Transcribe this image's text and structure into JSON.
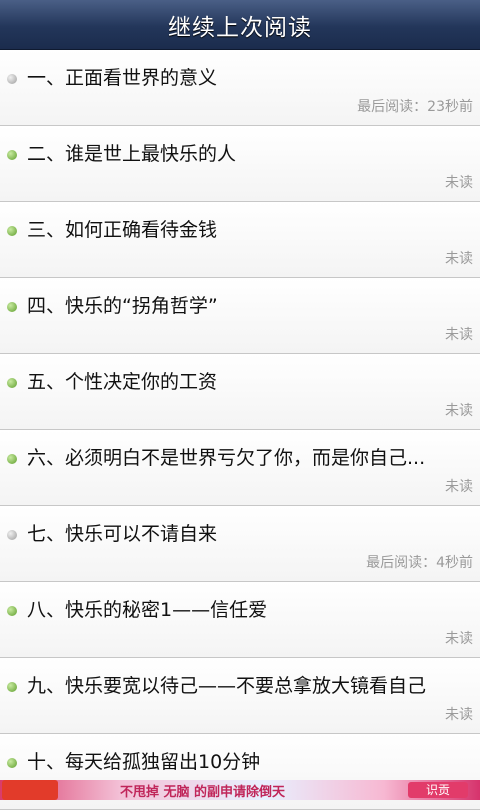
{
  "header": {
    "title": "继续上次阅读"
  },
  "items": [
    {
      "title": "一、正面看世界的意义",
      "status": "最后阅读：23秒前",
      "read": true
    },
    {
      "title": "二、谁是世上最快乐的人",
      "status": "未读",
      "read": false
    },
    {
      "title": "三、如何正确看待金钱",
      "status": "未读",
      "read": false
    },
    {
      "title": "四、快乐的“拐角哲学”",
      "status": "未读",
      "read": false
    },
    {
      "title": "五、个性决定你的工资",
      "status": "未读",
      "read": false
    },
    {
      "title": "六、必须明白不是世界亏欠了你，而是你自己...",
      "status": "未读",
      "read": false
    },
    {
      "title": "七、快乐可以不请自来",
      "status": "最后阅读：4秒前",
      "read": true
    },
    {
      "title": "八、快乐的秘密1——信任爱",
      "status": "未读",
      "read": false
    },
    {
      "title": "九、快乐要宽以待己——不要总拿放大镜看自己",
      "status": "未读",
      "read": false
    },
    {
      "title": "十、每天给孤独留出10分钟",
      "status": "",
      "read": false
    }
  ],
  "ad_banner": {
    "text": "不甩掉 无脑 的副申请除倒天",
    "button": "识贡"
  },
  "colors": {
    "header": "#23365a",
    "unread_dot": "#5d9d2b",
    "read_dot": "#9c9c9c",
    "status": "#9a9a9a"
  }
}
